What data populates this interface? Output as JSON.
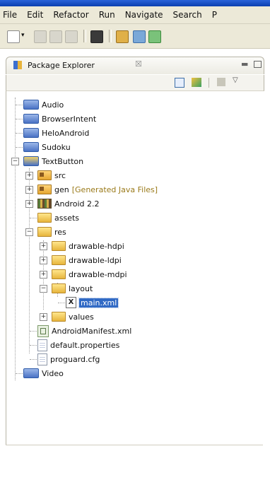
{
  "menubar": {
    "items": [
      "File",
      "Edit",
      "Refactor",
      "Run",
      "Navigate",
      "Search",
      "P"
    ]
  },
  "view": {
    "tab_label": "Package Explorer",
    "tab_close": "☒"
  },
  "tree": {
    "projects": [
      {
        "label": "Audio"
      },
      {
        "label": "BrowserIntent"
      },
      {
        "label": "HeloAndroid"
      },
      {
        "label": "Sudoku"
      },
      {
        "label": "TextButton"
      }
    ],
    "textbutton_children": {
      "src": "src",
      "gen": "gen",
      "gen_decoration": "[Generated Java Files]",
      "android": "Android 2.2",
      "assets": "assets",
      "res": "res",
      "res_children": {
        "drawable_hdpi": "drawable-hdpi",
        "drawable_ldpi": "drawable-ldpi",
        "drawable_mdpi": "drawable-mdpi",
        "layout": "layout",
        "layout_file": "main.xml",
        "values": "values"
      },
      "manifest": "AndroidManifest.xml",
      "default_properties": "default.properties",
      "proguard": "proguard.cfg"
    },
    "video": "Video"
  },
  "colors": {
    "selection": "#316ac5",
    "chrome": "#ece9d8",
    "titlebar": "#0b3fb0"
  }
}
